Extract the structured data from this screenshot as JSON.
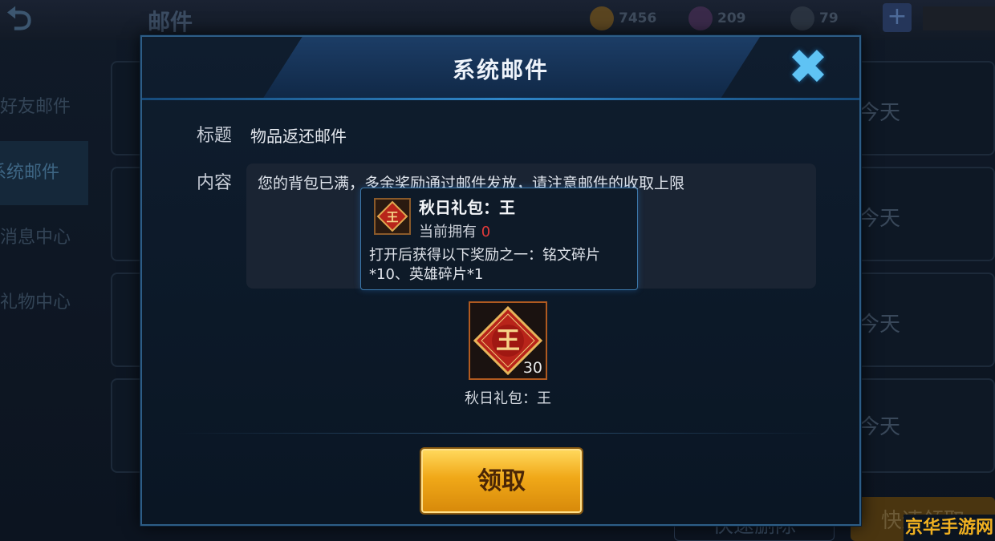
{
  "background": {
    "page_title": "邮件",
    "resources": [
      {
        "icon": "gold-coin-icon",
        "value": "7456"
      },
      {
        "icon": "gem-icon",
        "value": "209"
      },
      {
        "icon": "voucher-icon",
        "value": "79"
      }
    ],
    "sidebar": [
      {
        "label": "好友邮件"
      },
      {
        "label": "系统邮件",
        "active": true
      },
      {
        "label": "消息中心"
      },
      {
        "label": "礼物中心"
      }
    ],
    "mail_days": [
      "今天",
      "今天",
      "今天",
      "今天"
    ],
    "bottom_buttons": {
      "delete": "快速删除",
      "claim_all": "快速领取"
    }
  },
  "modal": {
    "title": "系统邮件",
    "subject_label": "标题",
    "subject_value": "物品返还邮件",
    "content_label": "内容",
    "content_text": "您的背包已满，多余奖励通过邮件发放，请注意邮件的收取上限",
    "tooltip": {
      "name": "秋日礼包：王",
      "own_label": "当前拥有",
      "own_count": "0",
      "description": "打开后获得以下奖励之一：铭文碎片*10、英雄碎片*1"
    },
    "item": {
      "icon_char": "王",
      "count": "30",
      "name": "秋日礼包：王"
    },
    "claim_label": "领取"
  },
  "watermark": "京华手游网"
}
